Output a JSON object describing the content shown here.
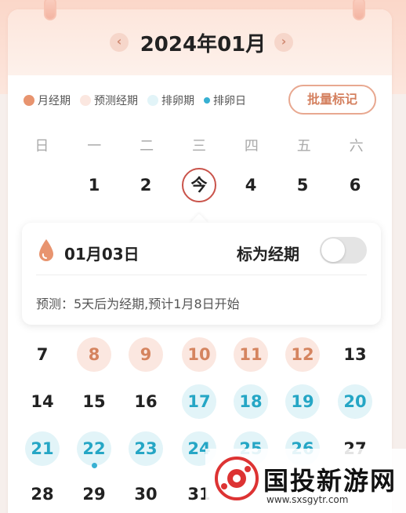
{
  "header": {
    "month_title": "2024年01月",
    "prev_icon": "chevron-left-icon",
    "next_icon": "chevron-right-icon",
    "prev_glyph": "‹",
    "next_glyph": "›"
  },
  "legend": [
    {
      "label": "月经期",
      "color": "#e8946f"
    },
    {
      "label": "预测经期",
      "color": "#fbe7e0"
    },
    {
      "label": "排卵期",
      "color": "#e2f4f8"
    },
    {
      "label": "排卵日",
      "color": "#37b0d2"
    }
  ],
  "batch_button": "批量标记",
  "weekdays": [
    "日",
    "一",
    "二",
    "三",
    "四",
    "五",
    "六"
  ],
  "today_label": "今",
  "weeks": [
    [
      {
        "d": ""
      },
      {
        "d": "1"
      },
      {
        "d": "2"
      },
      {
        "d": "今",
        "type": "today"
      },
      {
        "d": "4"
      },
      {
        "d": "5"
      },
      {
        "d": "6"
      }
    ],
    [
      {
        "d": "7"
      },
      {
        "d": "8",
        "type": "period"
      },
      {
        "d": "9",
        "type": "period"
      },
      {
        "d": "10",
        "type": "period"
      },
      {
        "d": "11",
        "type": "period"
      },
      {
        "d": "12",
        "type": "period"
      },
      {
        "d": "13"
      }
    ],
    [
      {
        "d": "14"
      },
      {
        "d": "15"
      },
      {
        "d": "16"
      },
      {
        "d": "17",
        "type": "ovul"
      },
      {
        "d": "18",
        "type": "ovul"
      },
      {
        "d": "19",
        "type": "ovul"
      },
      {
        "d": "20",
        "type": "ovul"
      }
    ],
    [
      {
        "d": "21",
        "type": "ovul"
      },
      {
        "d": "22",
        "type": "ovul",
        "dot": true
      },
      {
        "d": "23",
        "type": "ovul"
      },
      {
        "d": "24",
        "type": "ovul"
      },
      {
        "d": "25",
        "type": "ovul"
      },
      {
        "d": "26",
        "type": "ovul"
      },
      {
        "d": "27"
      }
    ],
    [
      {
        "d": "28"
      },
      {
        "d": "29"
      },
      {
        "d": "30"
      },
      {
        "d": "31"
      }
    ]
  ],
  "popup": {
    "date": "01月03日",
    "mark_label": "标为经期",
    "toggle_on": false,
    "prediction": "预测：5天后为经期,预计1月8日开始",
    "icon": "drop-icon"
  },
  "watermark": {
    "text": "国投新游网",
    "url": "www.sxsgytr.com"
  },
  "colors": {
    "accent": "#d5845f",
    "today_ring": "#c9534a",
    "ovulation": "#25a6c5"
  }
}
